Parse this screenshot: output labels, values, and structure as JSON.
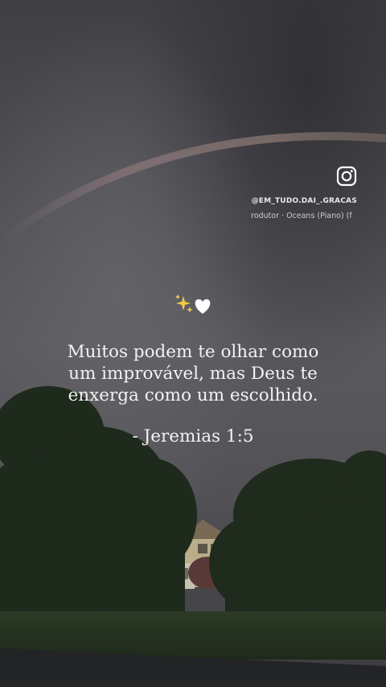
{
  "instagram": {
    "icon": "instagram-icon",
    "handle": "@EM_TUDO.DAI_.GRACAS"
  },
  "music_credit": "rodutor · Oceans (Piano) (f",
  "decoration": {
    "icons": [
      "sparkles-icon",
      "white-heart-icon"
    ]
  },
  "quote": {
    "lines": [
      "Muitos podem te olhar como",
      "um improvável, mas Deus te",
      "enxerga como um escolhido."
    ],
    "reference": "- Jeremias 1:5"
  },
  "colors": {
    "sky": "#54545a",
    "text": "#f2f2f2",
    "trees": "#1e2a1c",
    "house": "#b9ad8a"
  }
}
